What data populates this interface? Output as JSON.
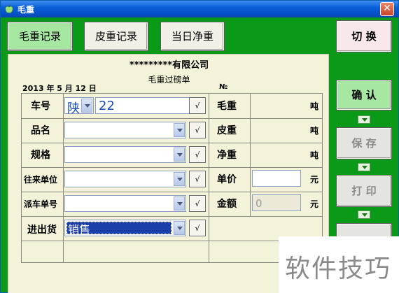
{
  "window": {
    "title": "毛重"
  },
  "tabs": {
    "gross_label": "毛重记录",
    "tare_label": "皮重记录",
    "daily_label": "当日净重",
    "switch_label": "切 换"
  },
  "side": {
    "confirm_label": "确 认",
    "save_label": "保 存",
    "print_label": "打 印"
  },
  "header": {
    "company": "*********有限公司",
    "doc_title": "毛重过磅单",
    "date": "2013 年  5   月 12  日",
    "no_label": "№"
  },
  "form": {
    "plate_label": "车号",
    "plate_prefix": "陕",
    "plate_value": "22",
    "product_label": "品名",
    "spec_label": "规格",
    "partner_label": "往来单位",
    "dispatch_label": "派车单号",
    "inout_label": "进出货",
    "inout_value": "销售",
    "check_mark": "√"
  },
  "weights": {
    "gross_label": "毛重",
    "tare_label": "皮重",
    "net_label": "净重",
    "ton_unit": "吨",
    "price_label": "单价",
    "amount_label": "金额",
    "amount_value": "0",
    "yuan_unit": "元"
  },
  "watermark": {
    "text": "软件技巧"
  },
  "colors": {
    "window_green": "#0a9a18",
    "panel": "#f4f2d8",
    "selected_blue": "#1a3fa8"
  }
}
